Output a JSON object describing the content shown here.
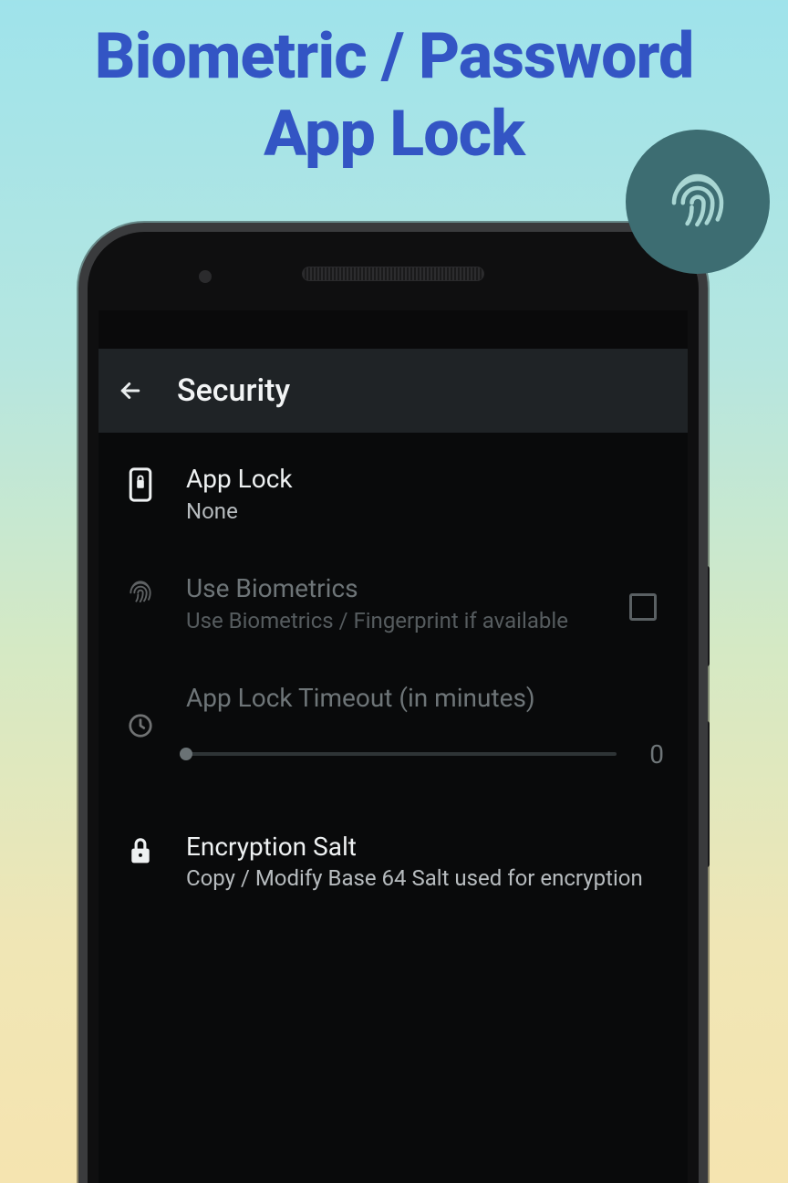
{
  "promo": {
    "line1": "Biometric / Password",
    "line2": "App Lock"
  },
  "appbar": {
    "title": "Security"
  },
  "settings": {
    "app_lock": {
      "label": "App Lock",
      "value": "None"
    },
    "biometrics": {
      "label": "Use Biometrics",
      "sub": "Use Biometrics / Fingerprint if available",
      "checked": false
    },
    "timeout": {
      "label": "App Lock Timeout (in minutes)",
      "value": "0"
    },
    "salt": {
      "label": "Encryption Salt",
      "sub": "Copy / Modify Base 64 Salt used for encryption"
    }
  }
}
